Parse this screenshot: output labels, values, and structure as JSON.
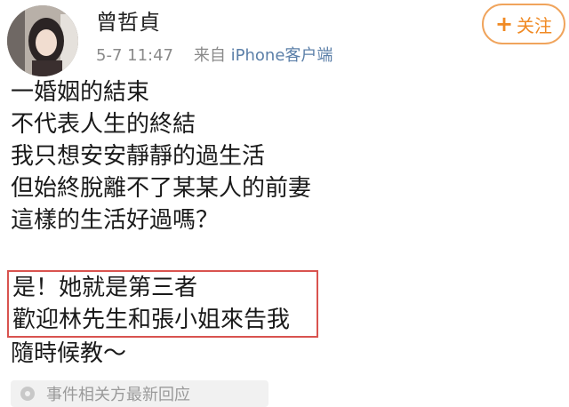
{
  "author": {
    "name": "曾哲貞",
    "timestamp": "5-7 11:47",
    "source_prefix": "来自",
    "source": "iPhone客户端"
  },
  "follow_button": {
    "icon": "+",
    "label": "关注"
  },
  "post": {
    "lines_top": [
      "一婚姻的結束",
      "不代表人生的終結",
      "我只想安安靜靜的過生活",
      "但始終脫離不了某某人的前妻",
      "這樣的生活好過嗎？"
    ],
    "highlighted_lines": [
      "是！她就是第三者",
      "歡迎林先生和張小姐來告我"
    ],
    "closing_line": "隨時候教～"
  },
  "footer": {
    "text": "事件相关方最新回应"
  },
  "colors": {
    "accent": "#f08a24",
    "link": "#5b7fa8",
    "highlight_border": "#d9534f"
  }
}
